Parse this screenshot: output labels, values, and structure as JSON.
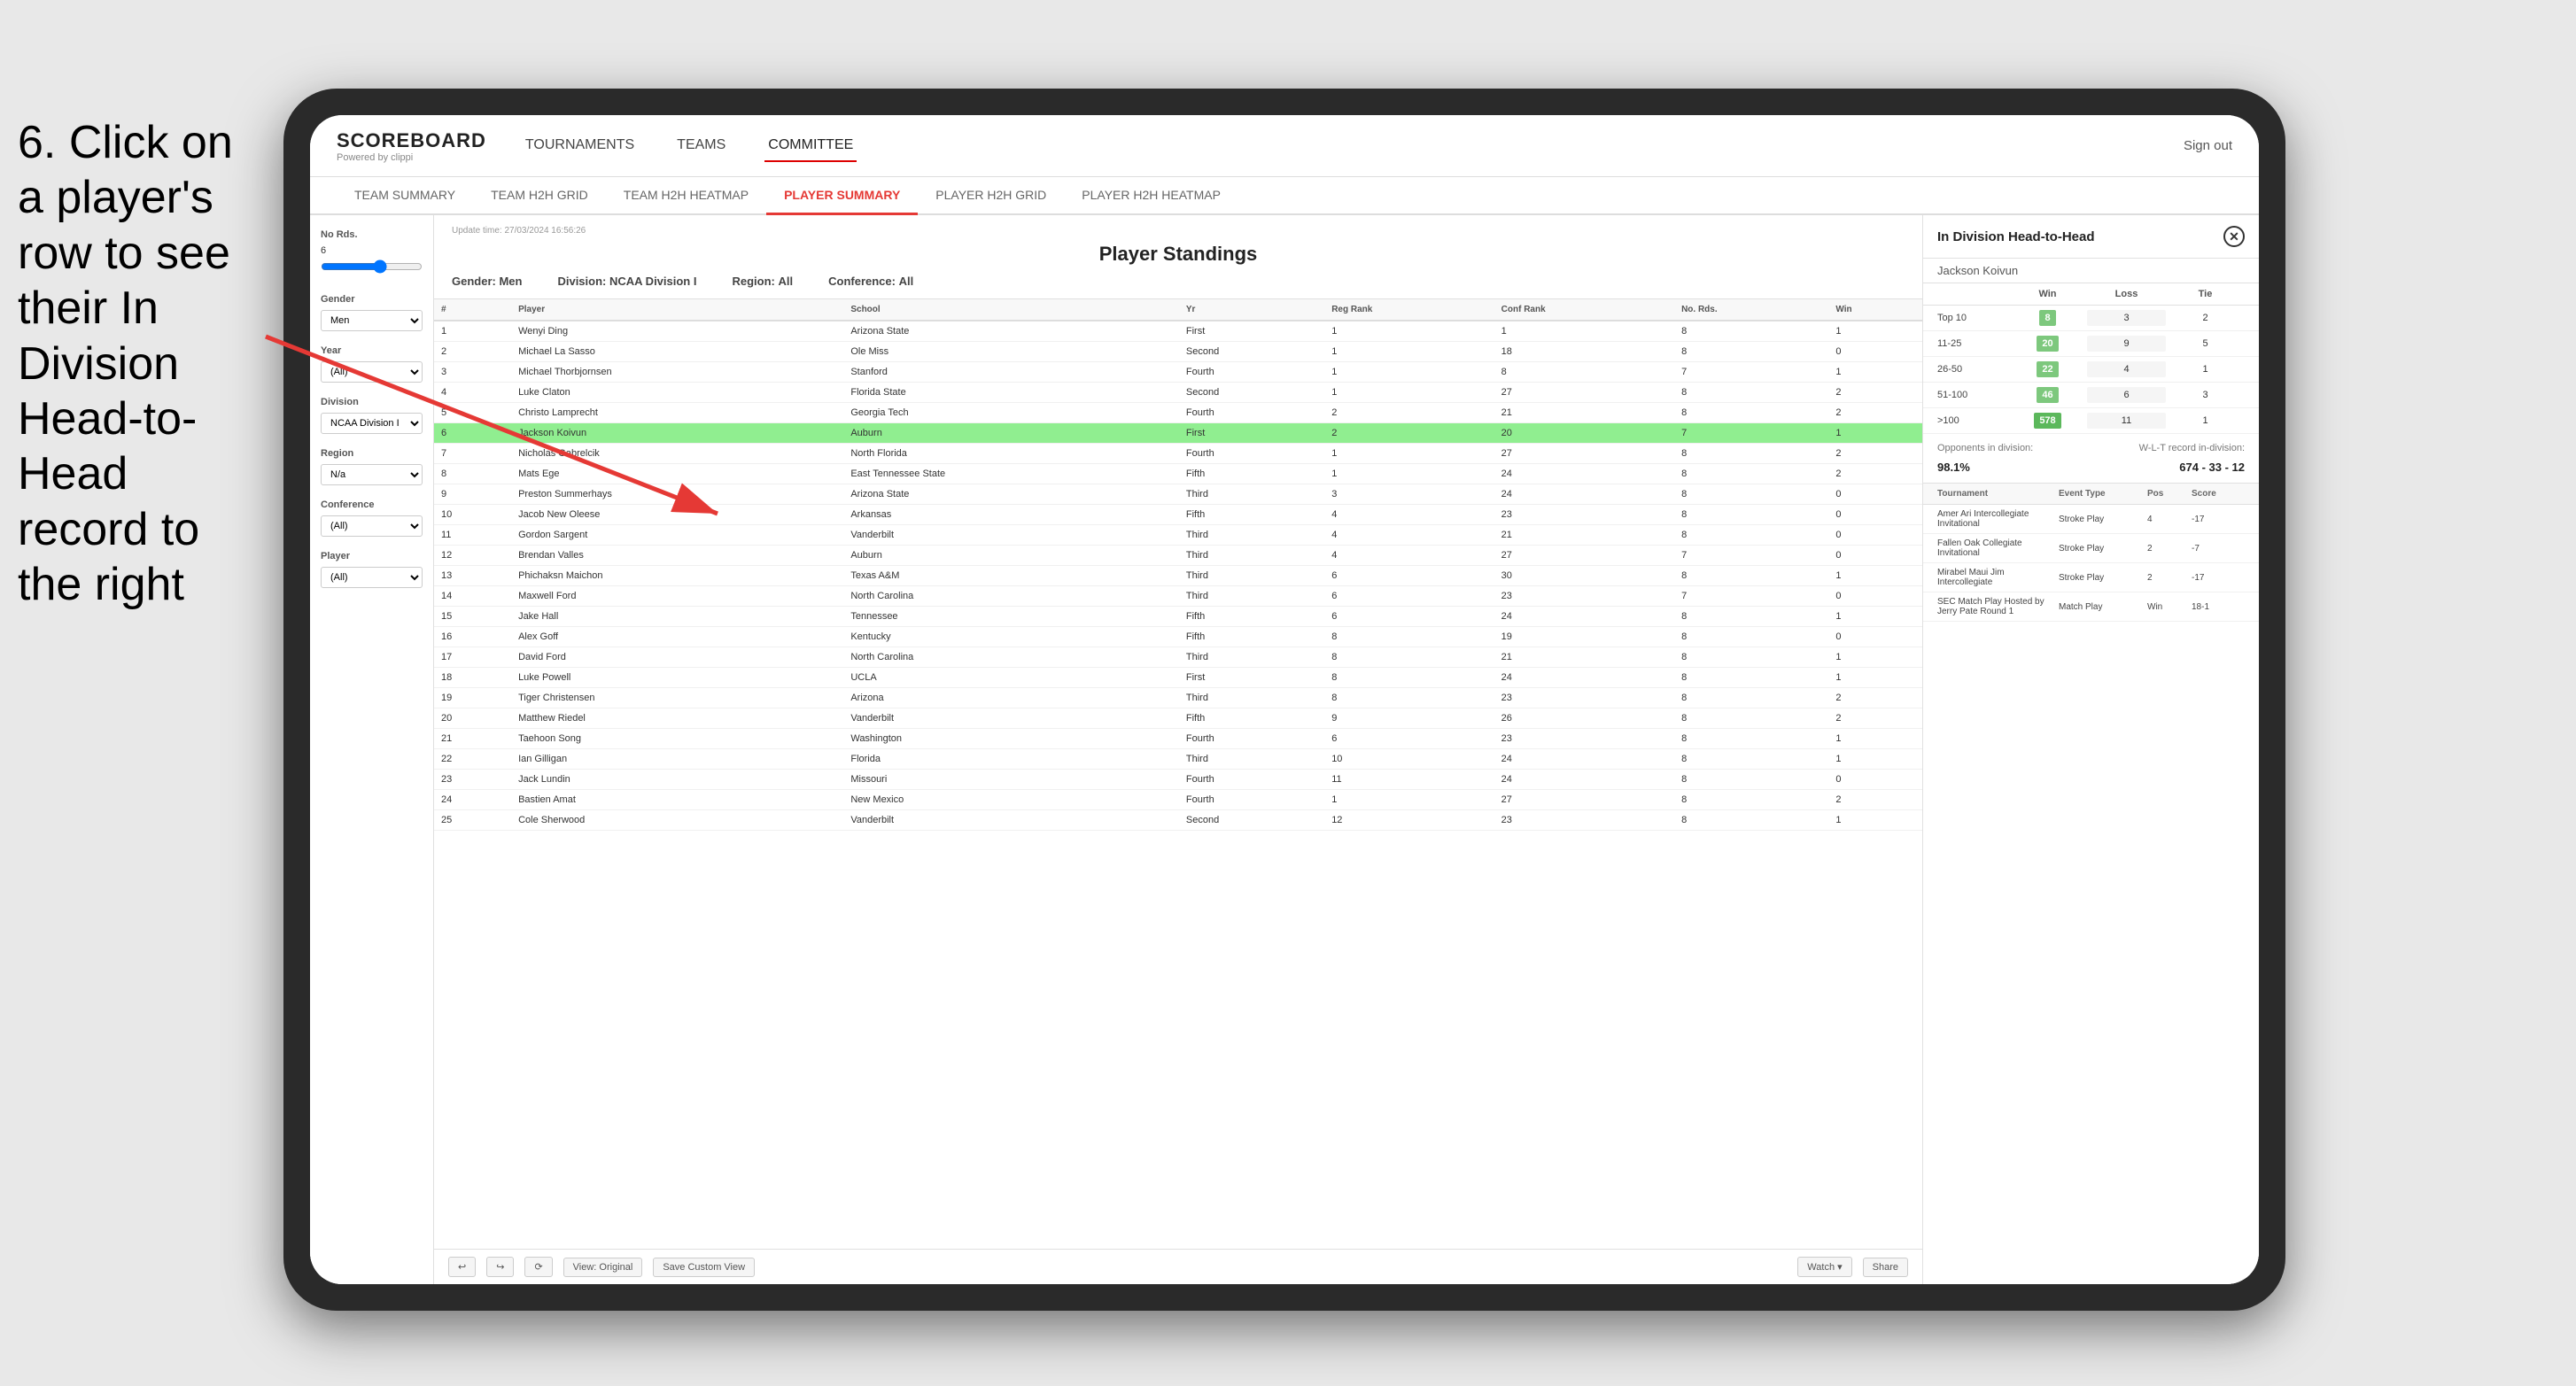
{
  "instruction": {
    "text": "6. Click on a player's row to see their In Division Head-to-Head record to the right"
  },
  "nav": {
    "logo": "SCOREBOARD",
    "logo_sub": "Powered by clippi",
    "items": [
      "TOURNAMENTS",
      "TEAMS",
      "COMMITTEE"
    ],
    "sign_out": "Sign out"
  },
  "sub_nav": {
    "items": [
      "TEAM SUMMARY",
      "TEAM H2H GRID",
      "TEAM H2H HEATMAP",
      "PLAYER SUMMARY",
      "PLAYER H2H GRID",
      "PLAYER H2H HEATMAP"
    ],
    "active": "PLAYER SUMMARY"
  },
  "standings": {
    "title": "Player Standings",
    "update_time": "Update time: 27/03/2024 16:56:26",
    "gender_label": "Gender:",
    "gender_value": "Men",
    "division_label": "Division:",
    "division_value": "NCAA Division I",
    "region_label": "Region:",
    "region_value": "All",
    "conference_label": "Conference:",
    "conference_value": "All"
  },
  "filters": {
    "no_rds_label": "No Rds.",
    "no_rds_value": "6",
    "gender_label": "Gender",
    "gender_value": "Men",
    "year_label": "Year",
    "year_value": "(All)",
    "division_label": "Division",
    "division_value": "NCAA Division I",
    "region_label": "Region",
    "region_value": "N/a",
    "conference_label": "Conference",
    "conference_value": "(All)",
    "player_label": "Player",
    "player_value": "(All)"
  },
  "table": {
    "headers": [
      "#",
      "Player",
      "School",
      "Yr",
      "Reg Rank",
      "Conf Rank",
      "No. Rds.",
      "Win"
    ],
    "rows": [
      {
        "rank": 1,
        "player": "Wenyi Ding",
        "school": "Arizona State",
        "yr": "First",
        "reg_rank": 1,
        "conf_rank": 1,
        "no_rds": 8,
        "win": 1,
        "highlighted": false
      },
      {
        "rank": 2,
        "player": "Michael La Sasso",
        "school": "Ole Miss",
        "yr": "Second",
        "reg_rank": 1,
        "conf_rank": 18,
        "no_rds": 8,
        "win": 0,
        "highlighted": false
      },
      {
        "rank": 3,
        "player": "Michael Thorbjornsen",
        "school": "Stanford",
        "yr": "Fourth",
        "reg_rank": 1,
        "conf_rank": 8,
        "no_rds": 7,
        "win": 1,
        "highlighted": false
      },
      {
        "rank": 4,
        "player": "Luke Claton",
        "school": "Florida State",
        "yr": "Second",
        "reg_rank": 1,
        "conf_rank": 27,
        "no_rds": 8,
        "win": 2,
        "highlighted": false
      },
      {
        "rank": 5,
        "player": "Christo Lamprecht",
        "school": "Georgia Tech",
        "yr": "Fourth",
        "reg_rank": 2,
        "conf_rank": 21,
        "no_rds": 8,
        "win": 2,
        "highlighted": false
      },
      {
        "rank": 6,
        "player": "Jackson Koivun",
        "school": "Auburn",
        "yr": "First",
        "reg_rank": 2,
        "conf_rank": 20,
        "no_rds": 7,
        "win": 1,
        "highlighted": true
      },
      {
        "rank": 7,
        "player": "Nicholas Gabrelcik",
        "school": "North Florida",
        "yr": "Fourth",
        "reg_rank": 1,
        "conf_rank": 27,
        "no_rds": 8,
        "win": 2,
        "highlighted": false
      },
      {
        "rank": 8,
        "player": "Mats Ege",
        "school": "East Tennessee State",
        "yr": "Fifth",
        "reg_rank": 1,
        "conf_rank": 24,
        "no_rds": 8,
        "win": 2,
        "highlighted": false
      },
      {
        "rank": 9,
        "player": "Preston Summerhays",
        "school": "Arizona State",
        "yr": "Third",
        "reg_rank": 3,
        "conf_rank": 24,
        "no_rds": 8,
        "win": 0,
        "highlighted": false
      },
      {
        "rank": 10,
        "player": "Jacob New Oleese",
        "school": "Arkansas",
        "yr": "Fifth",
        "reg_rank": 4,
        "conf_rank": 23,
        "no_rds": 8,
        "win": 0,
        "highlighted": false
      },
      {
        "rank": 11,
        "player": "Gordon Sargent",
        "school": "Vanderbilt",
        "yr": "Third",
        "reg_rank": 4,
        "conf_rank": 21,
        "no_rds": 8,
        "win": 0,
        "highlighted": false
      },
      {
        "rank": 12,
        "player": "Brendan Valles",
        "school": "Auburn",
        "yr": "Third",
        "reg_rank": 4,
        "conf_rank": 27,
        "no_rds": 7,
        "win": 0,
        "highlighted": false
      },
      {
        "rank": 13,
        "player": "Phichaksn Maichon",
        "school": "Texas A&M",
        "yr": "Third",
        "reg_rank": 6,
        "conf_rank": 30,
        "no_rds": 8,
        "win": 1,
        "highlighted": false
      },
      {
        "rank": 14,
        "player": "Maxwell Ford",
        "school": "North Carolina",
        "yr": "Third",
        "reg_rank": 6,
        "conf_rank": 23,
        "no_rds": 7,
        "win": 0,
        "highlighted": false
      },
      {
        "rank": 15,
        "player": "Jake Hall",
        "school": "Tennessee",
        "yr": "Fifth",
        "reg_rank": 6,
        "conf_rank": 24,
        "no_rds": 8,
        "win": 1,
        "highlighted": false
      },
      {
        "rank": 16,
        "player": "Alex Goff",
        "school": "Kentucky",
        "yr": "Fifth",
        "reg_rank": 8,
        "conf_rank": 19,
        "no_rds": 8,
        "win": 0,
        "highlighted": false
      },
      {
        "rank": 17,
        "player": "David Ford",
        "school": "North Carolina",
        "yr": "Third",
        "reg_rank": 8,
        "conf_rank": 21,
        "no_rds": 8,
        "win": 1,
        "highlighted": false
      },
      {
        "rank": 18,
        "player": "Luke Powell",
        "school": "UCLA",
        "yr": "First",
        "reg_rank": 8,
        "conf_rank": 24,
        "no_rds": 8,
        "win": 1,
        "highlighted": false
      },
      {
        "rank": 19,
        "player": "Tiger Christensen",
        "school": "Arizona",
        "yr": "Third",
        "reg_rank": 8,
        "conf_rank": 23,
        "no_rds": 8,
        "win": 2,
        "highlighted": false
      },
      {
        "rank": 20,
        "player": "Matthew Riedel",
        "school": "Vanderbilt",
        "yr": "Fifth",
        "reg_rank": 9,
        "conf_rank": 26,
        "no_rds": 8,
        "win": 2,
        "highlighted": false
      },
      {
        "rank": 21,
        "player": "Taehoon Song",
        "school": "Washington",
        "yr": "Fourth",
        "reg_rank": 6,
        "conf_rank": 23,
        "no_rds": 8,
        "win": 1,
        "highlighted": false
      },
      {
        "rank": 22,
        "player": "Ian Gilligan",
        "school": "Florida",
        "yr": "Third",
        "reg_rank": 10,
        "conf_rank": 24,
        "no_rds": 8,
        "win": 1,
        "highlighted": false
      },
      {
        "rank": 23,
        "player": "Jack Lundin",
        "school": "Missouri",
        "yr": "Fourth",
        "reg_rank": 11,
        "conf_rank": 24,
        "no_rds": 8,
        "win": 0,
        "highlighted": false
      },
      {
        "rank": 24,
        "player": "Bastien Amat",
        "school": "New Mexico",
        "yr": "Fourth",
        "reg_rank": 1,
        "conf_rank": 27,
        "no_rds": 8,
        "win": 2,
        "highlighted": false
      },
      {
        "rank": 25,
        "player": "Cole Sherwood",
        "school": "Vanderbilt",
        "yr": "Second",
        "reg_rank": 12,
        "conf_rank": 23,
        "no_rds": 8,
        "win": 1,
        "highlighted": false
      }
    ]
  },
  "h2h_panel": {
    "title": "In Division Head-to-Head",
    "player_name": "Jackson Koivun",
    "table_headers": [
      "",
      "Win",
      "Loss",
      "Tie"
    ],
    "rows": [
      {
        "range": "Top 10",
        "win": 8,
        "loss": 3,
        "tie": 2,
        "win_color": "#7dc87d"
      },
      {
        "range": "11-25",
        "win": 20,
        "loss": 9,
        "tie": 5,
        "win_color": "#7dc87d"
      },
      {
        "range": "26-50",
        "win": 22,
        "loss": 4,
        "tie": 1,
        "win_color": "#7dc87d"
      },
      {
        "range": "51-100",
        "win": 46,
        "loss": 6,
        "tie": 3,
        "win_color": "#7dc87d"
      },
      {
        "range": ">100",
        "win": 578,
        "loss": 11,
        "tie": 1,
        "win_color": "#5cb85c"
      }
    ],
    "opponents_label": "Opponents in division:",
    "wlt_label": "W-L-T record in-division:",
    "opponents_value": "98.1%",
    "wlt_value": "674 - 33 - 12",
    "tournament_headers": [
      "Tournament",
      "Event Type",
      "Pos",
      "Score"
    ],
    "tournaments": [
      {
        "name": "Amer Ari Intercollegiate Invitational",
        "event_type": "Stroke Play",
        "pos": 4,
        "score": "-17"
      },
      {
        "name": "Fallen Oak Collegiate Invitational",
        "event_type": "Stroke Play",
        "pos": 2,
        "score": "-7"
      },
      {
        "name": "Mirabel Maui Jim Intercollegiate",
        "event_type": "Stroke Play",
        "pos": 2,
        "score": "-17"
      },
      {
        "name": "SEC Match Play Hosted by Jerry Pate Round 1",
        "event_type": "Match Play",
        "pos": "Win",
        "score": "18-1"
      }
    ]
  },
  "toolbar": {
    "view_original": "View: Original",
    "save_custom": "Save Custom View",
    "watch": "Watch ▾",
    "share": "Share"
  }
}
